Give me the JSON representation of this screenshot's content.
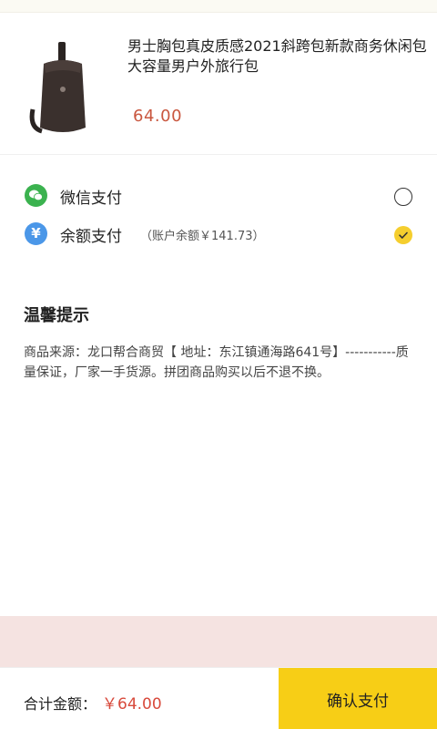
{
  "product": {
    "title": "男士胸包真皮质感2021斜跨包新款商务休闲包大容量男户外旅行包",
    "price": "64.00"
  },
  "payment": {
    "options": [
      {
        "label": "微信支付",
        "icon": "wechat-icon",
        "selected": false
      },
      {
        "label": "余额支付",
        "sub": "（账户余额￥141.73）",
        "icon": "yen-icon",
        "selected": true
      }
    ]
  },
  "tips": {
    "title": "温馨提示",
    "body": "商品来源：龙口帮合商贸【 地址：东江镇通海路641号】-----------质量保证，厂家一手货源。拼团商品购买以后不退不换。"
  },
  "footer": {
    "total_label": "合计金额：",
    "total_amount": "￥64.00",
    "confirm_label": "确认支付"
  },
  "colors": {
    "accent": "#f7ce16",
    "price": "#c9573f",
    "wechat": "#3bb24f",
    "balance": "#4b97e8",
    "band": "#f5e3e1"
  }
}
